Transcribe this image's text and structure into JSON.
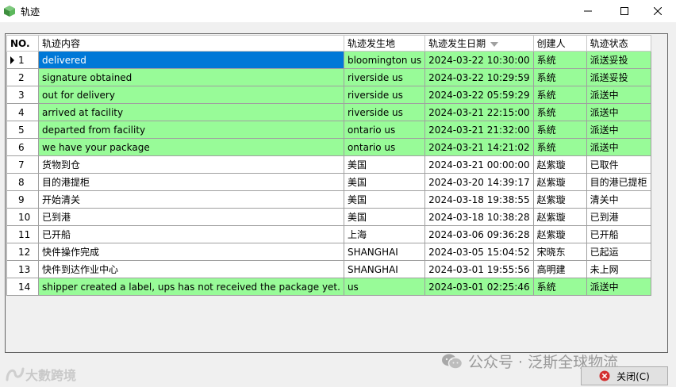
{
  "window": {
    "title": "轨迹"
  },
  "table": {
    "columns": [
      "NO.",
      "轨迹内容",
      "轨迹发生地",
      "轨迹发生日期",
      "创建人",
      "轨迹状态"
    ],
    "rows": [
      {
        "no": "1",
        "content": "delivered",
        "place": "bloomington us",
        "date": "2024-03-22 10:30:00",
        "creator": "系统",
        "status": "派送妥投"
      },
      {
        "no": "2",
        "content": "signature obtained",
        "place": "riverside us",
        "date": "2024-03-22 10:29:59",
        "creator": "系统",
        "status": "派送妥投"
      },
      {
        "no": "3",
        "content": "out for delivery",
        "place": "riverside us",
        "date": "2024-03-22 05:59:29",
        "creator": "系统",
        "status": "派送中"
      },
      {
        "no": "4",
        "content": "arrived at facility",
        "place": "riverside us",
        "date": "2024-03-21 22:15:00",
        "creator": "系统",
        "status": "派送中"
      },
      {
        "no": "5",
        "content": "departed from facility",
        "place": "ontario us",
        "date": "2024-03-21 21:32:00",
        "creator": "系统",
        "status": "派送中"
      },
      {
        "no": "6",
        "content": "we have your package",
        "place": "ontario us",
        "date": "2024-03-21 14:21:02",
        "creator": "系统",
        "status": "派送中"
      },
      {
        "no": "7",
        "content": "货物到仓",
        "place": "美国",
        "date": "2024-03-21 00:00:00",
        "creator": "赵紫璇",
        "status": "已取件"
      },
      {
        "no": "8",
        "content": "目的港提柜",
        "place": "美国",
        "date": "2024-03-20 14:39:17",
        "creator": "赵紫璇",
        "status": "目的港已提柜"
      },
      {
        "no": "9",
        "content": "开始清关",
        "place": "美国",
        "date": "2024-03-18 19:38:55",
        "creator": "赵紫璇",
        "status": "清关中"
      },
      {
        "no": "10",
        "content": "已到港",
        "place": "美国",
        "date": "2024-03-18 10:38:28",
        "creator": "赵紫璇",
        "status": "已到港"
      },
      {
        "no": "11",
        "content": "已开船",
        "place": "上海",
        "date": "2024-03-06 09:36:28",
        "creator": "赵紫璇",
        "status": "已开船"
      },
      {
        "no": "12",
        "content": "快件操作完成",
        "place": "SHANGHAI",
        "date": "2024-03-05 15:04:52",
        "creator": "宋晓东",
        "status": "已起运"
      },
      {
        "no": "13",
        "content": "快件到达作业中心",
        "place": "SHANGHAI",
        "date": "2024-03-01 19:55:56",
        "creator": "高明建",
        "status": "未上网"
      },
      {
        "no": "14",
        "content": "shipper created a label, ups has not received the package yet.",
        "place": " us",
        "date": "2024-03-01 02:25:46",
        "creator": "系统",
        "status": "派送中"
      }
    ]
  },
  "footer": {
    "logo_text": "大數跨境",
    "watermark_text": "公众号 · 泛斯全球物流",
    "close_label": "关闭(C)"
  },
  "colors": {
    "system_row": "#98fb98",
    "selected_cell": "#0078d7",
    "manual_row": "#ffffff"
  }
}
